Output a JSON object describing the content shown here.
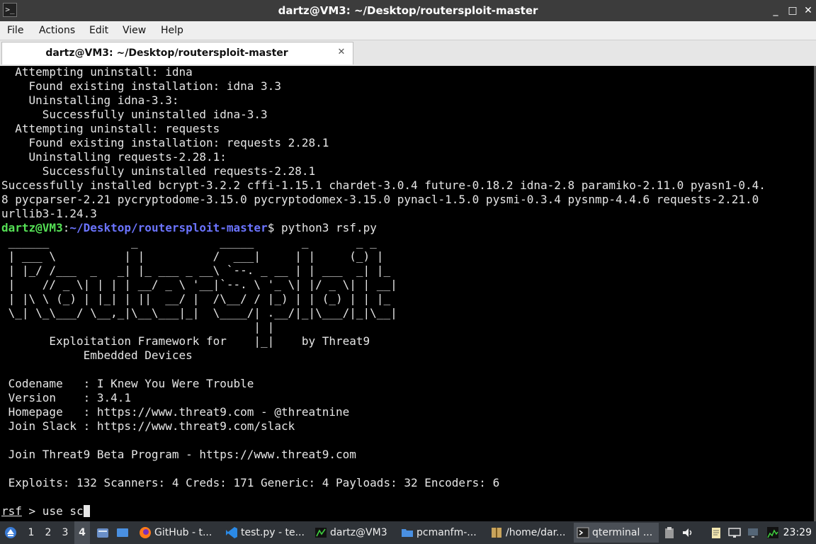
{
  "window": {
    "title": "dartz@VM3: ~/Desktop/routersploit-master",
    "minimize_glyph": "_",
    "maximize_glyph": "□",
    "close_glyph": "✕"
  },
  "menubar": {
    "items": [
      "File",
      "Actions",
      "Edit",
      "View",
      "Help"
    ]
  },
  "tab": {
    "label": "dartz@VM3: ~/Desktop/routersploit-master",
    "close_glyph": "✕"
  },
  "terminal": {
    "pip_output": [
      "  Attempting uninstall: idna",
      "    Found existing installation: idna 3.3",
      "    Uninstalling idna-3.3:",
      "      Successfully uninstalled idna-3.3",
      "  Attempting uninstall: requests",
      "    Found existing installation: requests 2.28.1",
      "    Uninstalling requests-2.28.1:",
      "      Successfully uninstalled requests-2.28.1",
      "Successfully installed bcrypt-3.2.2 cffi-1.15.1 chardet-3.0.4 future-0.18.2 idna-2.8 paramiko-2.11.0 pyasn1-0.4.",
      "8 pycparser-2.21 pycryptodome-3.15.0 pycryptodomex-3.15.0 pynacl-1.5.0 pysmi-0.3.4 pysnmp-4.4.6 requests-2.21.0",
      "urllib3-1.24.3"
    ],
    "prompt": {
      "user_host": "dartz@VM3",
      "separator": ":",
      "path": "~/Desktop/routersploit-master",
      "symbol": "$",
      "command": " python3 rsf.py"
    },
    "banner": [
      " ______            _            _____       _       _ _",
      " | ___ \\          | |          /  ___|     | |     (_) |",
      " | |_/ /___  _   _| |_ ___ _ __\\ `--. _ __ | | ___  _| |_",
      " |    // _ \\| | | | __/ _ \\ '__|`--. \\ '_ \\| |/ _ \\| | __|",
      " | |\\ \\ (_) | |_| | ||  __/ |  /\\__/ / |_) | | (_) | | |_",
      " \\_| \\_\\___/ \\__,_|\\__\\___|_|  \\____/| .__/|_|\\___/|_|\\__|",
      "                                     | |",
      "       Exploitation Framework for    |_|    by Threat9",
      "            Embedded Devices"
    ],
    "info": [
      " Codename   : I Knew You Were Trouble",
      " Version    : 3.4.1",
      " Homepage   : https://www.threat9.com - @threatnine",
      " Join Slack : https://www.threat9.com/slack"
    ],
    "beta": " Join Threat9 Beta Program - https://www.threat9.com",
    "stats": " Exploits: 132 Scanners: 4 Creds: 171 Generic: 4 Payloads: 32 Encoders: 6",
    "rsf_prompt": {
      "name": "rsf",
      "rest": " > use sc"
    }
  },
  "taskbar": {
    "workspaces": [
      "1",
      "2",
      "3",
      "4"
    ],
    "active_workspace": "4",
    "tasks": [
      {
        "label": "GitHub - t...",
        "icon": "firefox-icon"
      },
      {
        "label": "test.py - te...",
        "icon": "vscode-icon"
      },
      {
        "label": "dartz@VM3",
        "icon": "terminal-icon"
      },
      {
        "label": "pcmanfm-...",
        "icon": "folder-icon"
      },
      {
        "label": "/home/dar...",
        "icon": "archive-icon"
      },
      {
        "label": "qterminal ...",
        "icon": "terminal-icon"
      }
    ],
    "clock": "23:29"
  },
  "colors": {
    "terminal_bg": "#000000",
    "terminal_fg": "#e6e6e6",
    "prompt_user": "#55e055",
    "prompt_path": "#6b74ff",
    "titlebar_bg": "#3c3c3c",
    "taskbar_bg": "#2f3338"
  }
}
